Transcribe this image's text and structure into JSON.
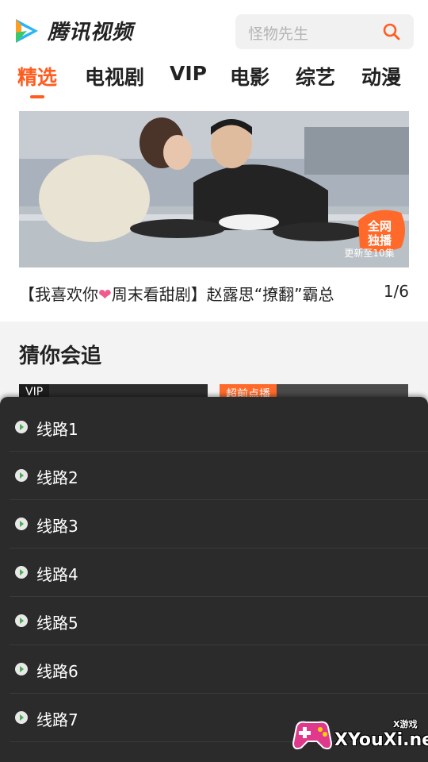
{
  "header": {
    "app_name": "腾讯视频",
    "search_placeholder": "怪物先生",
    "logo_icon": "tencent-video-logo",
    "search_icon": "search-icon"
  },
  "tabs": [
    {
      "label": "精选",
      "active": true
    },
    {
      "label": "电视剧",
      "active": false
    },
    {
      "label": "VIP",
      "active": false
    },
    {
      "label": "电影",
      "active": false
    },
    {
      "label": "综艺",
      "active": false
    },
    {
      "label": "动漫",
      "active": false
    }
  ],
  "banner": {
    "caption_pre": "【我喜欢你",
    "caption_post": "周末看甜剧】赵露思“撩翻”霸总",
    "counter": "1/6",
    "badge_line1": "全网",
    "badge_line2": "独播",
    "update_text": "更新至10集"
  },
  "section": {
    "title": "猜你会追",
    "cards": [
      {
        "badge": "VIP"
      },
      {
        "badge": "超前点播"
      }
    ]
  },
  "route_sheet": {
    "items": [
      {
        "label": "线路1"
      },
      {
        "label": "线路2"
      },
      {
        "label": "线路3"
      },
      {
        "label": "线路4"
      },
      {
        "label": "线路5"
      },
      {
        "label": "线路6"
      },
      {
        "label": "线路7"
      }
    ]
  },
  "watermark": {
    "text": "XYouXi.net",
    "sub": "X游戏"
  },
  "colors": {
    "accent": "#ff5d1f",
    "sheet_bg": "#2b2b2b",
    "route_icon": "#4caf50"
  }
}
